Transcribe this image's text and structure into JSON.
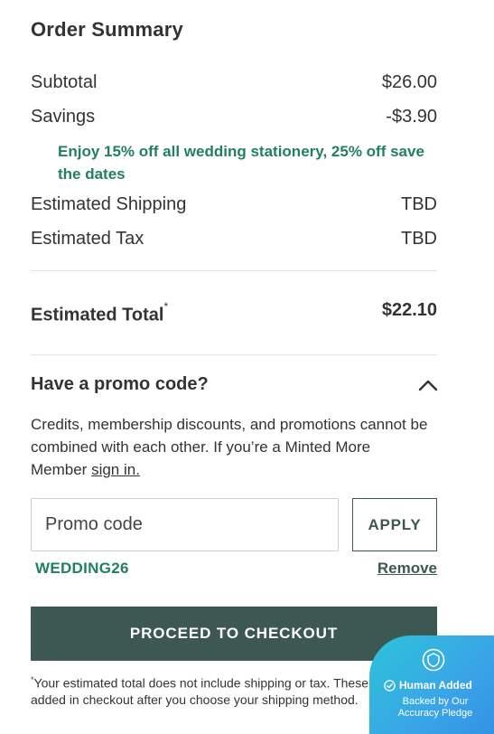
{
  "summary": {
    "title": "Order Summary",
    "subtotal_label": "Subtotal",
    "subtotal_value": "$26.00",
    "savings_label": "Savings",
    "savings_value": "-$3.90",
    "promo_note": "Enjoy 15% off all wedding stationery, 25% off save the dates",
    "shipping_label": "Estimated Shipping",
    "shipping_value": "TBD",
    "tax_label": "Estimated Tax",
    "tax_value": "TBD",
    "total_label": "Estimated Total",
    "total_asterisk": "*",
    "total_value": "$22.10"
  },
  "promo": {
    "heading": "Have a promo code?",
    "description": "Credits, membership discounts, and promotions cannot be combined with each other. If you’re a Minted More Member ",
    "signin_link": "sign in.",
    "input_placeholder": "Promo code",
    "apply_label": "APPLY",
    "applied_code": "WEDDING26",
    "remove_label": "Remove"
  },
  "checkout": {
    "button_label": "PROCEED TO CHECKOUT",
    "disclaimer_asterisk": "*",
    "disclaimer": "Your estimated total does not include shipping or tax. These will be added in checkout after you choose your shipping method."
  },
  "badge": {
    "title": "Human Added",
    "subtitle": "Backed by Our Accuracy Pledge",
    "icons": [
      "shield-icon",
      "check-circle-icon"
    ]
  },
  "colors": {
    "brand_dark": "#3d5753",
    "accent_green": "#21805f",
    "badge_teal": "#2cc4d8"
  }
}
